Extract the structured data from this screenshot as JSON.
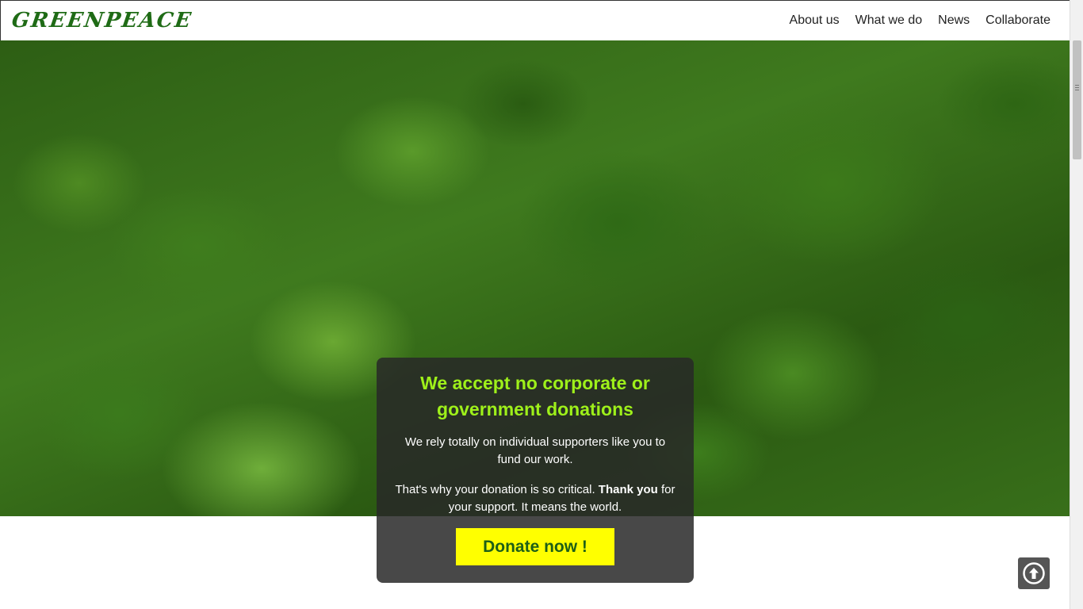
{
  "header": {
    "logo_text": "GREENPEACE",
    "nav": [
      {
        "label": "About us"
      },
      {
        "label": "What we do"
      },
      {
        "label": "News"
      },
      {
        "label": "Collaborate"
      }
    ]
  },
  "donation": {
    "title": "We accept no corporate or government donations",
    "text1": "We rely totally on individual supporters like you to fund our work.",
    "text2_before": "That's why your donation is so critical. ",
    "text2_bold": "Thank you",
    "text2_after": " for your support. It means the world.",
    "button_label": "Donate now !"
  },
  "colors": {
    "brand_green": "#1f6b16",
    "accent_lime": "#9ef01a",
    "button_yellow": "#ffff00"
  },
  "icons": {
    "back_to_top": "arrow-up-circle-icon"
  }
}
